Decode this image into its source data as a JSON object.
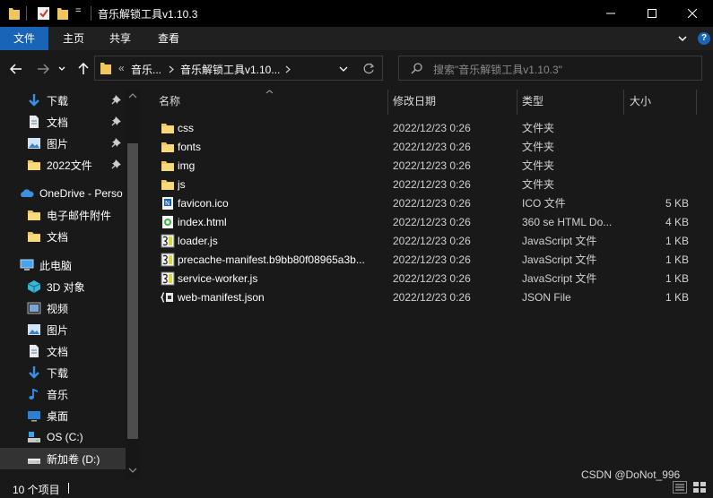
{
  "window": {
    "title": "音乐解锁工具v1.10.3",
    "quick_access_dropdown": "="
  },
  "ribbon": {
    "tabs": [
      "文件",
      "主页",
      "共享",
      "查看"
    ],
    "help": "?"
  },
  "address": {
    "overflow": "«",
    "crumbs": [
      "音乐...",
      "音乐解锁工具v1.10..."
    ],
    "search_placeholder": "搜索\"音乐解锁工具v1.10.3\""
  },
  "nav": {
    "items": [
      {
        "label": "下载",
        "icon": "download-arrow-icon",
        "pinned": true
      },
      {
        "label": "文档",
        "icon": "document-icon",
        "pinned": true
      },
      {
        "label": "图片",
        "icon": "pictures-icon",
        "pinned": true
      },
      {
        "label": "2022文件",
        "icon": "folder-icon",
        "pinned": true
      },
      {
        "label": "OneDrive - Perso",
        "icon": "onedrive-cloud-icon",
        "pinned": false
      },
      {
        "label": "电子邮件附件",
        "icon": "folder-icon",
        "pinned": false
      },
      {
        "label": "文档",
        "icon": "folder-icon",
        "pinned": false
      },
      {
        "label": "此电脑",
        "icon": "this-pc-icon",
        "pinned": false
      },
      {
        "label": "3D 对象",
        "icon": "3d-objects-icon",
        "pinned": false
      },
      {
        "label": "视频",
        "icon": "video-icon",
        "pinned": false
      },
      {
        "label": "图片",
        "icon": "pictures-icon",
        "pinned": false
      },
      {
        "label": "文档",
        "icon": "document-icon",
        "pinned": false
      },
      {
        "label": "下载",
        "icon": "download-arrow-icon",
        "pinned": false
      },
      {
        "label": "音乐",
        "icon": "music-note-icon",
        "pinned": false
      },
      {
        "label": "桌面",
        "icon": "desktop-icon",
        "pinned": false
      },
      {
        "label": "OS (C:)",
        "icon": "system-drive-icon",
        "pinned": false
      },
      {
        "label": "新加卷 (D:)",
        "icon": "drive-icon",
        "pinned": false
      }
    ]
  },
  "columns": {
    "name": "名称",
    "date": "修改日期",
    "type": "类型",
    "size": "大小"
  },
  "files": [
    {
      "name": "css",
      "date": "2022/12/23 0:26",
      "type": "文件夹",
      "size": "",
      "icon": "folder-icon"
    },
    {
      "name": "fonts",
      "date": "2022/12/23 0:26",
      "type": "文件夹",
      "size": "",
      "icon": "folder-icon"
    },
    {
      "name": "img",
      "date": "2022/12/23 0:26",
      "type": "文件夹",
      "size": "",
      "icon": "folder-icon"
    },
    {
      "name": "js",
      "date": "2022/12/23 0:26",
      "type": "文件夹",
      "size": "",
      "icon": "folder-icon"
    },
    {
      "name": "favicon.ico",
      "date": "2022/12/23 0:26",
      "type": "ICO 文件",
      "size": "5 KB",
      "icon": "ico-file-icon"
    },
    {
      "name": "index.html",
      "date": "2022/12/23 0:26",
      "type": "360 se HTML Do...",
      "size": "4 KB",
      "icon": "html-file-icon"
    },
    {
      "name": "loader.js",
      "date": "2022/12/23 0:26",
      "type": "JavaScript 文件",
      "size": "1 KB",
      "icon": "js-file-icon"
    },
    {
      "name": "precache-manifest.b9bb80f08965a3b...",
      "date": "2022/12/23 0:26",
      "type": "JavaScript 文件",
      "size": "1 KB",
      "icon": "js-file-icon"
    },
    {
      "name": "service-worker.js",
      "date": "2022/12/23 0:26",
      "type": "JavaScript 文件",
      "size": "1 KB",
      "icon": "js-file-icon"
    },
    {
      "name": "web-manifest.json",
      "date": "2022/12/23 0:26",
      "type": "JSON File",
      "size": "1 KB",
      "icon": "json-file-icon"
    }
  ],
  "status": {
    "count": "10 个项目",
    "watermark": "CSDN @DoNot_996"
  },
  "colors": {
    "accent": "#1a64b8",
    "folder": "#f0c75e",
    "background": "#191919",
    "titlebar": "#000000"
  }
}
